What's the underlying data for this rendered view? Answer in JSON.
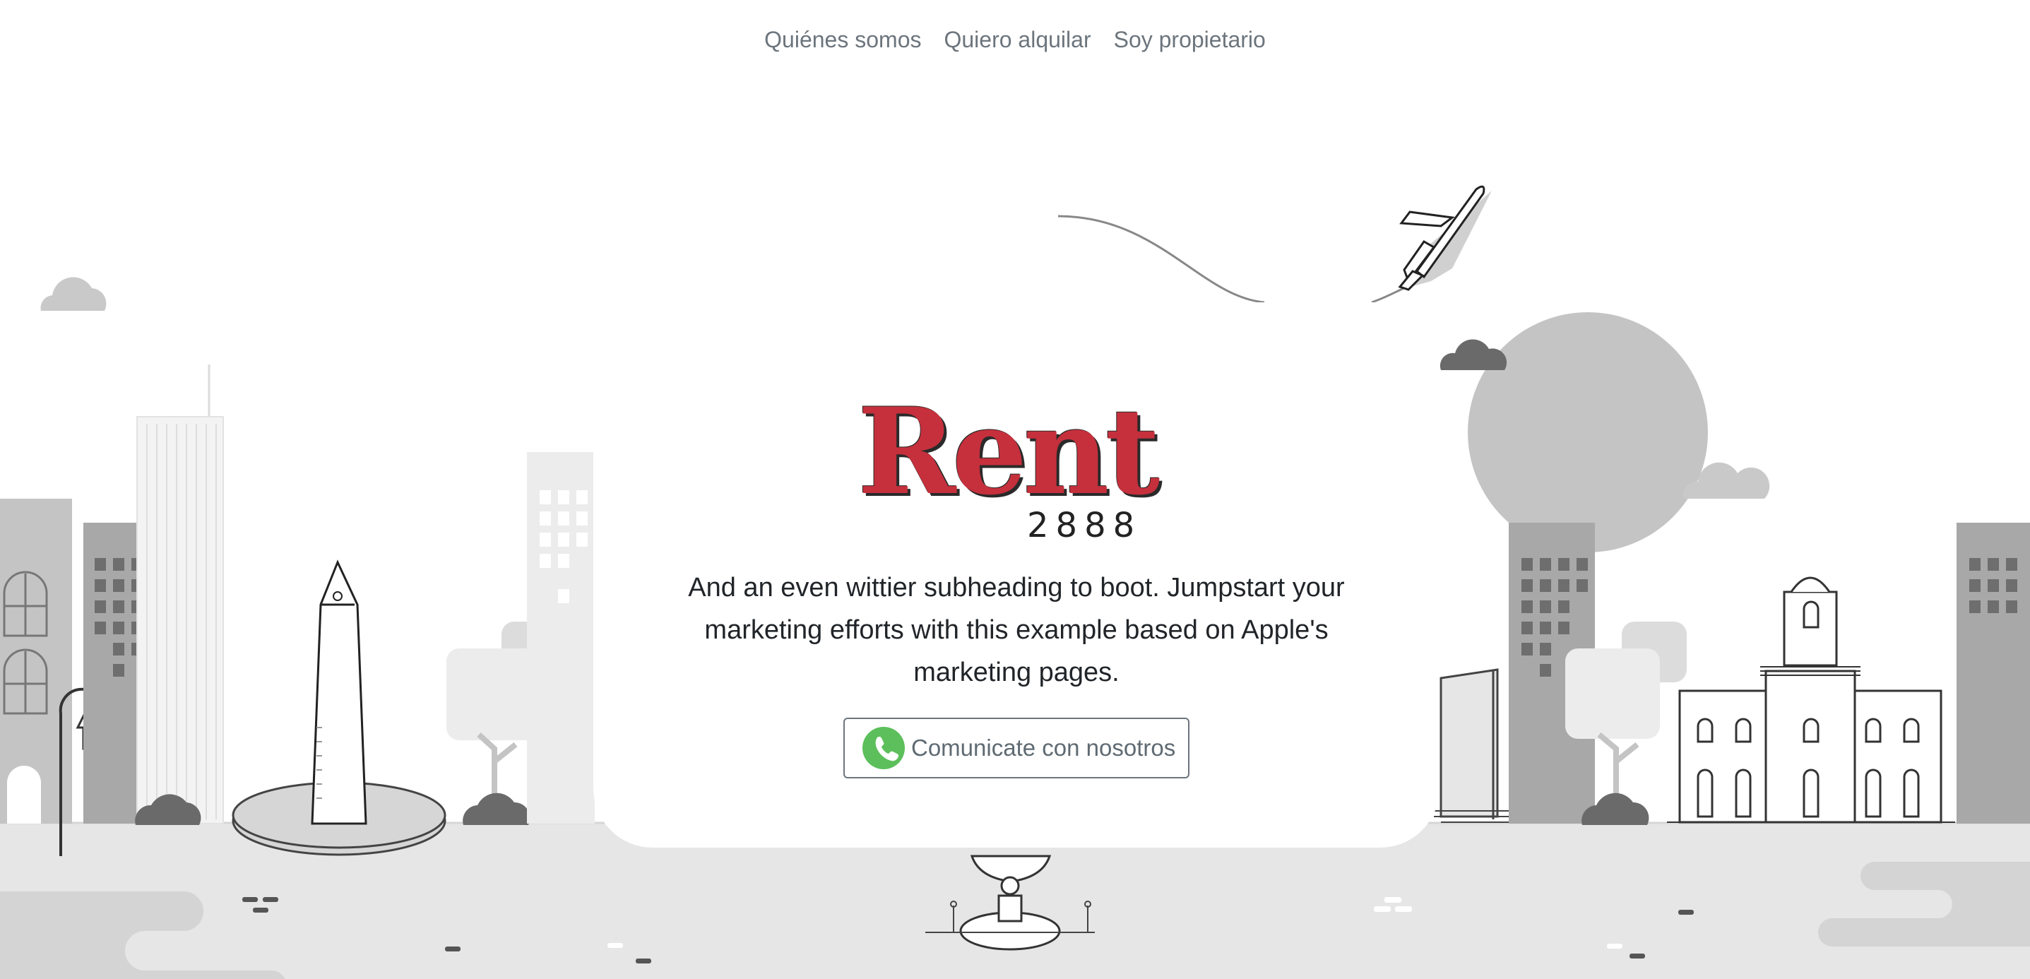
{
  "nav": {
    "items": [
      {
        "label": "Quiénes somos"
      },
      {
        "label": "Quiero alquilar"
      },
      {
        "label": "Soy propietario"
      }
    ]
  },
  "logo": {
    "word": "Rent",
    "number": "2888"
  },
  "hero": {
    "subheading": "And an even wittier subheading to boot. Jumpstart your marketing efforts with this example based on Apple's marketing pages.",
    "cta_label": "Comunicate con nosotros",
    "cta_icon": "whatsapp-icon"
  },
  "colors": {
    "brand_red": "#c5303c",
    "whatsapp_green": "#5cbf5b",
    "nav_text": "#6c757d",
    "scene_gray": "#c4c4c4",
    "ground": "#e4e4e4"
  }
}
